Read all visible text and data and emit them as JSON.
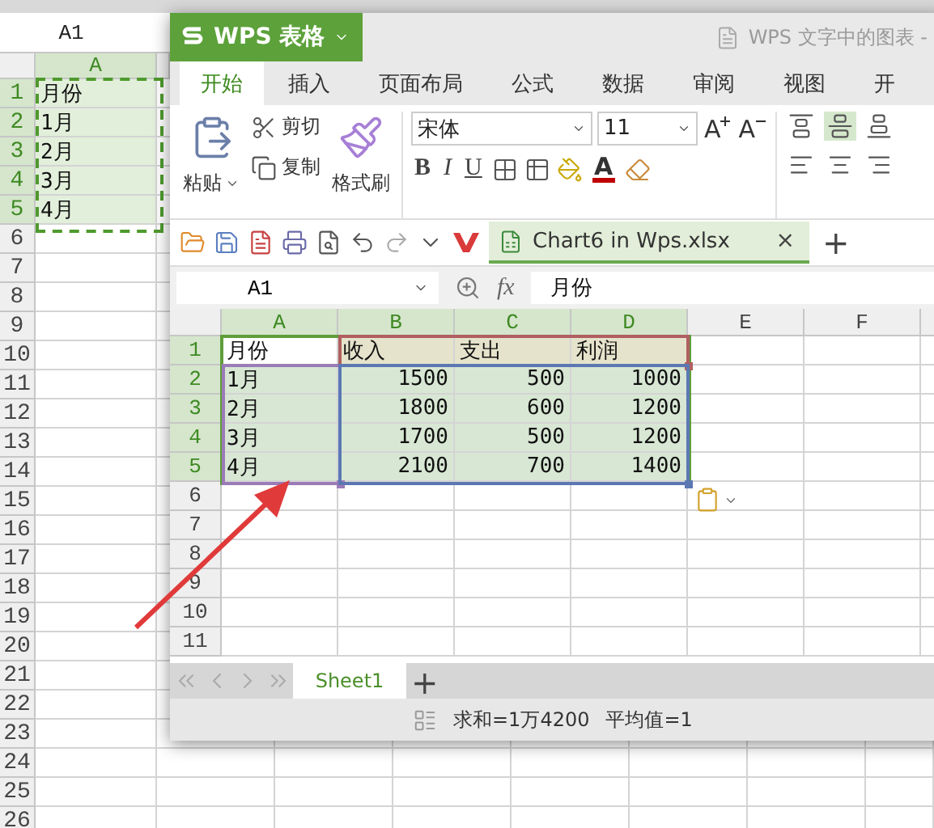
{
  "back_sheet": {
    "name_box": "A1",
    "columns": [
      {
        "label": "A",
        "selected": true
      }
    ],
    "rows": [
      {
        "number": "1",
        "selected": true,
        "cells": [
          "月份"
        ]
      },
      {
        "number": "2",
        "selected": true,
        "cells": [
          "1月"
        ]
      },
      {
        "number": "3",
        "selected": true,
        "cells": [
          "2月"
        ]
      },
      {
        "number": "4",
        "selected": true,
        "cells": [
          "3月"
        ]
      },
      {
        "number": "5",
        "selected": true,
        "cells": [
          "4月"
        ]
      },
      {
        "number": "6",
        "selected": false
      },
      {
        "number": "7",
        "selected": false
      },
      {
        "number": "8",
        "selected": false
      },
      {
        "number": "9",
        "selected": false
      },
      {
        "number": "10",
        "selected": false
      },
      {
        "number": "11",
        "selected": false
      },
      {
        "number": "12",
        "selected": false
      },
      {
        "number": "13",
        "selected": false
      },
      {
        "number": "14",
        "selected": false
      },
      {
        "number": "15",
        "selected": false
      },
      {
        "number": "16",
        "selected": false
      },
      {
        "number": "17",
        "selected": false
      },
      {
        "number": "18",
        "selected": false
      },
      {
        "number": "19",
        "selected": false
      },
      {
        "number": "20",
        "selected": false
      },
      {
        "number": "21",
        "selected": false
      },
      {
        "number": "22",
        "selected": false
      },
      {
        "number": "23",
        "selected": false
      },
      {
        "number": "24",
        "selected": false
      },
      {
        "number": "25",
        "selected": false
      },
      {
        "number": "26",
        "selected": false
      }
    ]
  },
  "window": {
    "app_button": "WPS 表格",
    "title": "WPS 文字中的图表 -",
    "tabs": [
      {
        "label": "开始",
        "selected": true
      },
      {
        "label": "插入",
        "selected": false
      },
      {
        "label": "页面布局",
        "selected": false
      },
      {
        "label": "公式",
        "selected": false
      },
      {
        "label": "数据",
        "selected": false
      },
      {
        "label": "审阅",
        "selected": false
      },
      {
        "label": "视图",
        "selected": false
      },
      {
        "label": "开",
        "selected": false
      }
    ],
    "ribbon": {
      "paste": "粘贴",
      "clipboard": [
        {
          "label": "剪切",
          "kind": "cut"
        },
        {
          "label": "复制",
          "kind": "copy"
        }
      ],
      "format_painter": "格式刷",
      "font": {
        "name": "宋体",
        "size": "11",
        "grow": "A",
        "shrink": "A",
        "styles": [
          {
            "label": "B",
            "kind": "bold"
          },
          {
            "label": "I",
            "kind": "italic"
          },
          {
            "label": "U",
            "kind": "underline"
          }
        ],
        "font_color": "A"
      },
      "alignment": [
        {
          "kind": "top",
          "selected": false
        },
        {
          "kind": "middle",
          "selected": true
        },
        {
          "kind": "bottom",
          "selected": false
        },
        {
          "kind": "left",
          "selected": false
        },
        {
          "kind": "center",
          "selected": false
        },
        {
          "kind": "right",
          "selected": false
        }
      ]
    },
    "document_tab": {
      "label": "Chart6 in Wps.xlsx",
      "close": "×",
      "add": "+"
    },
    "formula_bar": {
      "name_box": "A1",
      "fx": "fx",
      "value": "月份"
    },
    "sheet": {
      "columns": [
        {
          "label": "A",
          "selected": true
        },
        {
          "label": "B",
          "selected": true
        },
        {
          "label": "C",
          "selected": true
        },
        {
          "label": "D",
          "selected": true
        },
        {
          "label": "E",
          "selected": false
        },
        {
          "label": "F",
          "selected": false
        }
      ],
      "rows": [
        {
          "number": "1",
          "selected": true,
          "cells": [
            "月份",
            "收入",
            "支出",
            "利润"
          ]
        },
        {
          "number": "2",
          "selected": true,
          "cells": [
            "1月",
            "1500",
            "500",
            "1000"
          ]
        },
        {
          "number": "3",
          "selected": true,
          "cells": [
            "2月",
            "1800",
            "600",
            "1200"
          ]
        },
        {
          "number": "4",
          "selected": true,
          "cells": [
            "3月",
            "1700",
            "500",
            "1200"
          ]
        },
        {
          "number": "5",
          "selected": true,
          "cells": [
            "4月",
            "2100",
            "700",
            "1400"
          ]
        },
        {
          "number": "6",
          "selected": false
        },
        {
          "number": "7",
          "selected": false
        },
        {
          "number": "8",
          "selected": false
        },
        {
          "number": "9",
          "selected": false
        },
        {
          "number": "10",
          "selected": false
        },
        {
          "number": "11",
          "selected": false
        }
      ]
    },
    "sheet_tabs": [
      {
        "label": "Sheet1",
        "selected": true
      }
    ],
    "add_sheet": "+",
    "status_bar": [
      "求和=1万4200",
      "平均值=1"
    ]
  }
}
